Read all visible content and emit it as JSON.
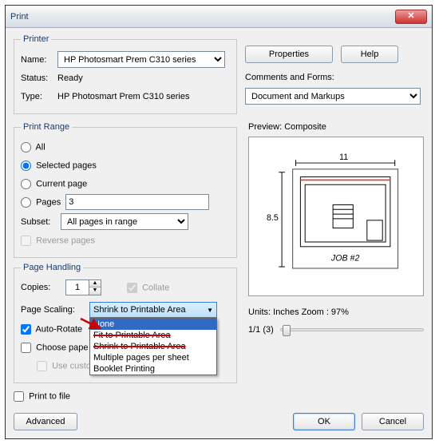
{
  "title": "Print",
  "printer": {
    "legend": "Printer",
    "name_label": "Name:",
    "name_value": "HP Photosmart Prem C310 series",
    "status_label": "Status:",
    "status_value": "Ready",
    "type_label": "Type:",
    "type_value": "HP Photosmart Prem C310 series"
  },
  "buttons": {
    "properties": "Properties",
    "help": "Help",
    "ok": "OK",
    "cancel": "Cancel",
    "advanced": "Advanced"
  },
  "comments": {
    "label": "Comments and Forms:",
    "value": "Document and Markups"
  },
  "range": {
    "legend": "Print Range",
    "all": "All",
    "selected": "Selected pages",
    "current": "Current page",
    "pages": "Pages",
    "pages_value": "3",
    "subset_label": "Subset:",
    "subset_value": "All pages in range",
    "reverse": "Reverse pages"
  },
  "handling": {
    "legend": "Page Handling",
    "copies_label": "Copies:",
    "copies_value": "1",
    "collate": "Collate",
    "scaling_label": "Page Scaling:",
    "scaling_selected": "Shrink to Printable Area",
    "options": {
      "none": "None",
      "fit": "Fit to Printable Area",
      "shrink": "Shrink to Printable Area",
      "multiple": "Multiple pages per sheet",
      "booklet": "Booklet Printing"
    },
    "autorotate": "Auto-Rotate",
    "choose_paper": "Choose pape",
    "custom_size": "Use custom paper size when needed"
  },
  "print_to_file": "Print to file",
  "preview": {
    "label": "Preview: Composite",
    "width": "11",
    "height": "8.5",
    "job": "JOB #2",
    "units": "Units: Inches Zoom :  97%",
    "page": "1/1 (3)"
  }
}
